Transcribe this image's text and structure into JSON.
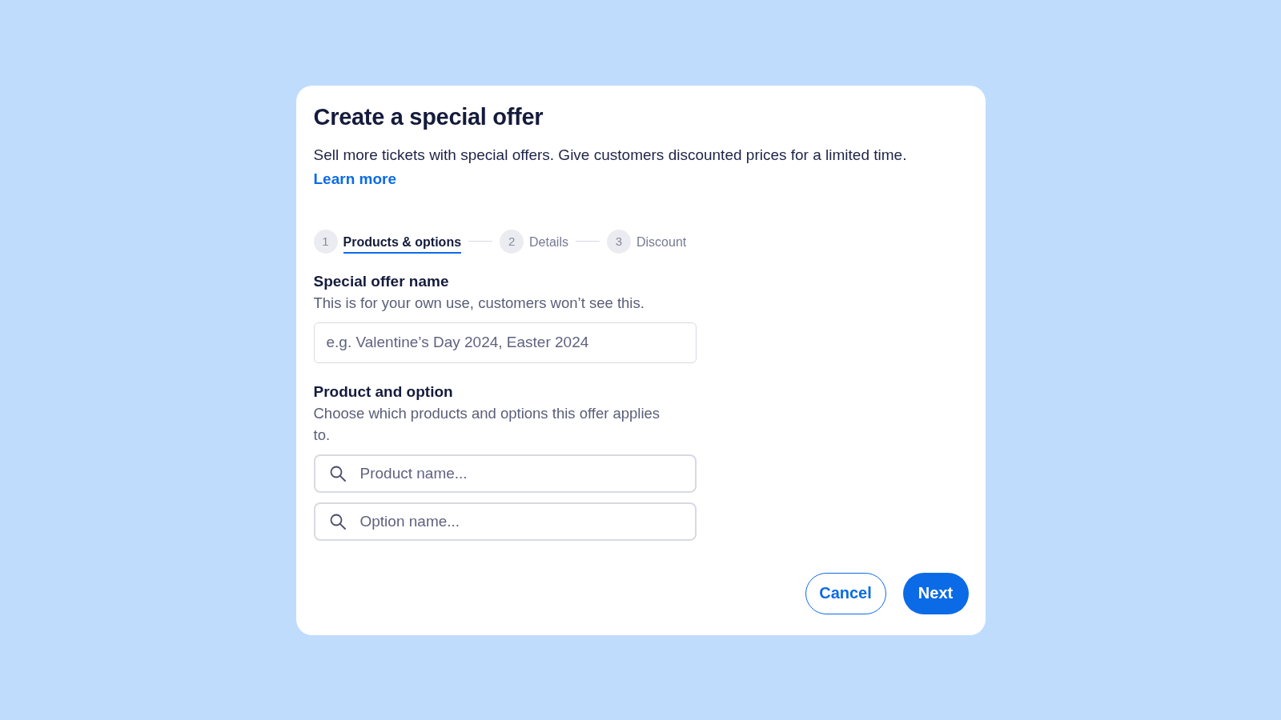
{
  "dialog": {
    "title": "Create a special offer",
    "description": "Sell more tickets with special offers. Give customers discounted prices for a limited time.",
    "link": "Learn more"
  },
  "steps": [
    {
      "number": "1",
      "label": "Products & options",
      "selected": true
    },
    {
      "number": "2",
      "label": "Details",
      "selected": false
    },
    {
      "number": "3",
      "label": "Discount",
      "selected": false
    }
  ],
  "sections": [
    {
      "label": "Special offer name",
      "hint": "This is for your own use, customers won’t see this.",
      "inputs": [
        {
          "kind": "text",
          "placeholder": "e.g. Valentine’s Day 2024, Easter 2024"
        }
      ]
    },
    {
      "label": "Product and option",
      "hint": "Choose which products and options this offer applies to.",
      "inputs": [
        {
          "kind": "search",
          "placeholder": "Product name..."
        },
        {
          "kind": "search",
          "placeholder": "Option name..."
        }
      ]
    }
  ],
  "buttons": [
    {
      "label": "Cancel",
      "kind": "secondary"
    },
    {
      "label": "Next",
      "kind": "primary"
    }
  ]
}
